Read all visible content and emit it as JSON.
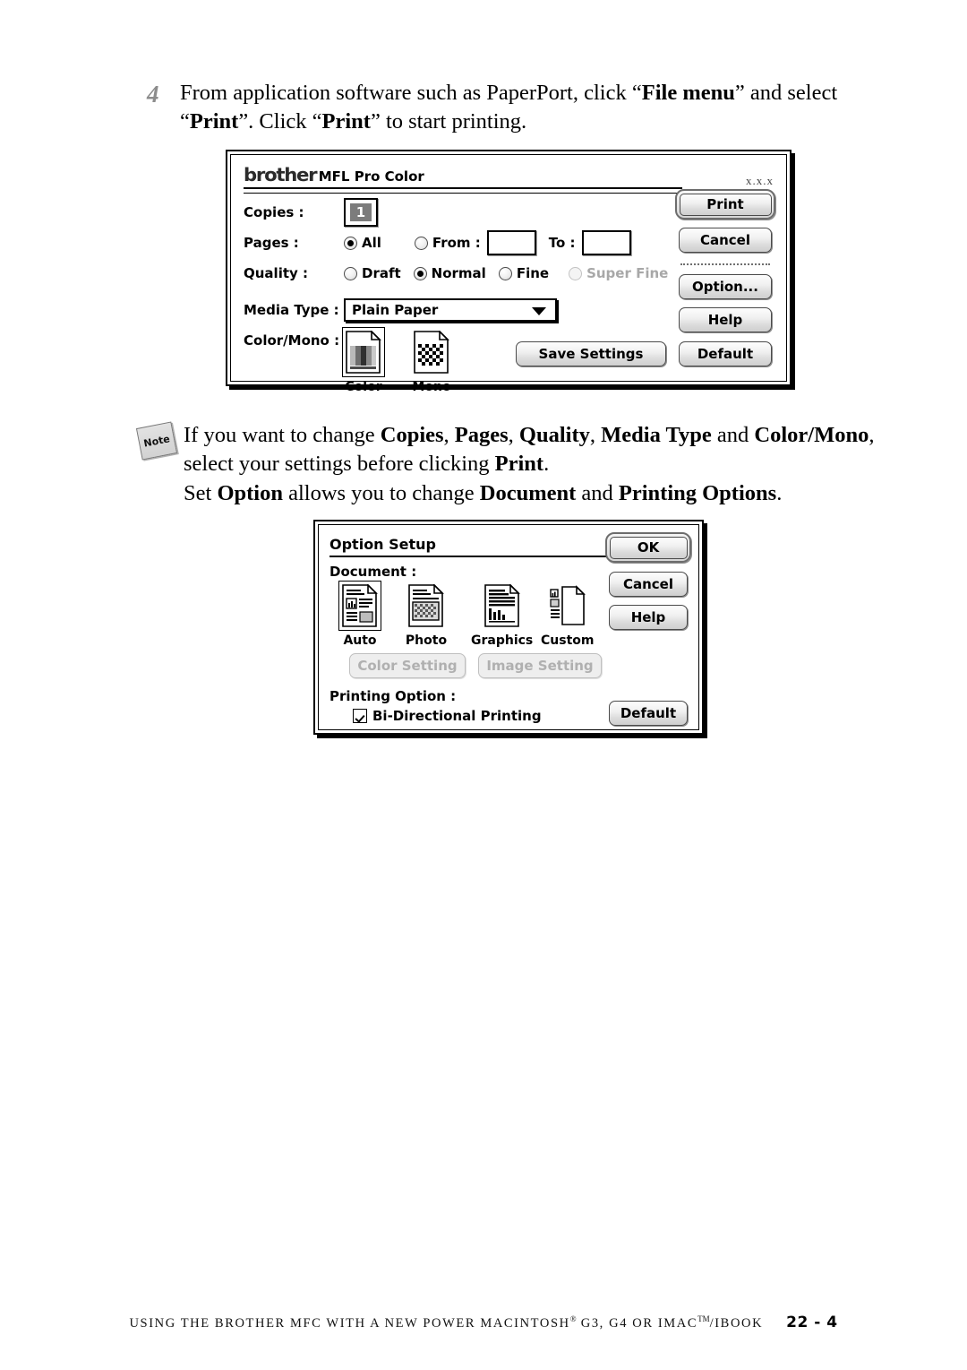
{
  "step": {
    "number": "4",
    "line1_a": "From application software such as PaperPort, click “",
    "line1_b": "File menu",
    "line1_c": "” and select",
    "line2_a": "“",
    "line2_b": "Print",
    "line2_c": "”. Click “",
    "line2_d": "Print",
    "line2_e": "” to start printing."
  },
  "print_dialog": {
    "brand": "brother",
    "model": "MFL Pro Color",
    "version": "x.x.x",
    "copies": {
      "label": "Copies :",
      "value": "1"
    },
    "pages": {
      "label": "Pages :",
      "all_label": "All",
      "all_selected": true,
      "from_label": "From :",
      "from_value": "",
      "to_label": "To :",
      "to_value": ""
    },
    "quality": {
      "label": "Quality :",
      "options": [
        "Draft",
        "Normal",
        "Fine",
        "Super Fine"
      ],
      "selected": "Normal",
      "disabled": [
        "Super Fine"
      ]
    },
    "media_type": {
      "label": "Media Type :",
      "value": "Plain Paper"
    },
    "color_mono": {
      "label": "Color/Mono :",
      "options": [
        "Color",
        "Mono"
      ],
      "selected": "Color"
    },
    "buttons": {
      "print": "Print",
      "cancel": "Cancel",
      "option": "Option...",
      "help": "Help",
      "save_settings": "Save Settings",
      "default": "Default"
    }
  },
  "note": {
    "badge": "Note",
    "l1_a": "If you want to change ",
    "l1_b": "Copies",
    "l1_c": ", ",
    "l1_d": "Pages",
    "l1_e": ", ",
    "l1_f": "Quality",
    "l1_g": ", ",
    "l1_h": "Media Type",
    "l1_i": " and ",
    "l1_j": "Color/Mono",
    "l1_k": ",",
    "l2_a": "select your settings before clicking ",
    "l2_b": "Print",
    "l2_c": ".",
    "l3_a": "Set ",
    "l3_b": "Option",
    "l3_c": " allows you to change ",
    "l3_d": "Document",
    "l3_e": " and ",
    "l3_f": "Printing Options",
    "l3_g": "."
  },
  "option_dialog": {
    "title": "Option Setup",
    "document": {
      "label": "Document :",
      "options": [
        "Auto",
        "Photo",
        "Graphics",
        "Custom"
      ],
      "selected": "Auto"
    },
    "setting_buttons": {
      "color_setting": "Color Setting",
      "image_setting": "Image Setting",
      "disabled": true
    },
    "printing_option": {
      "label": "Printing Option :",
      "bidirectional_label": "Bi-Directional Printing",
      "bidirectional_checked": true
    },
    "buttons": {
      "ok": "OK",
      "cancel": "Cancel",
      "help": "Help",
      "default": "Default"
    }
  },
  "footer": {
    "text_a": "USING THE BROTHER MFC WITH A NEW POWER MACINTOSH",
    "sup_r": "®",
    "text_b": " G3, G4 OR IMAC",
    "sup_tm": "TM",
    "text_c": "/IBOOK",
    "page": "22 - 4"
  }
}
